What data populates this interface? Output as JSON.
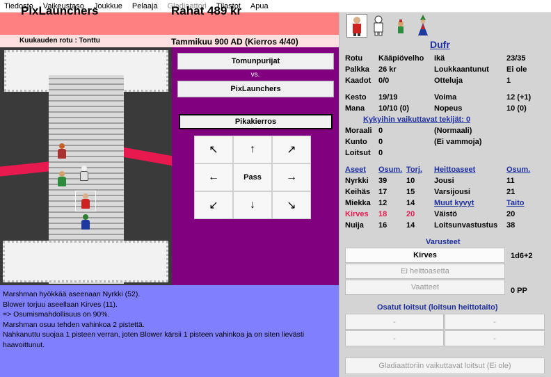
{
  "menu": [
    "Tiedosto",
    "Vaikeustaso",
    "Joukkue",
    "Pelaaja",
    "Gladiaattori",
    "Tilastot",
    "Apua"
  ],
  "header": {
    "team": "PixLaunchers",
    "money": "Rahat 489 kr",
    "race_of_month": "Kuukauden rotu : Tonttu",
    "date": "Tammikuu 900 AD (Kierros 4/40)"
  },
  "match": {
    "team1": "Tomunpurijat",
    "vs": "vs.",
    "team2": "PixLaunchers",
    "quick_round": "Pikakierros"
  },
  "directions": {
    "nw": "↖",
    "n": "↑",
    "ne": "↗",
    "w": "←",
    "pass": "Pass",
    "e": "→",
    "sw": "↙",
    "s": "↓",
    "se": "↘"
  },
  "log": [
    "Marshman hyökkää aseenaan Nyrkki (52).",
    "Blower torjuu aseellaan Kirves (11).",
    "=> Osumismahdollisuus on 90%.",
    "Marshman osuu  tehden vahinkoa 2 pistettä.",
    "Nahkanuttu suojaa 1 pisteen verran, joten Blower kärsii 1 pisteen vahinkoa ja on siten lievästi",
    "haavoittunut."
  ],
  "gladiator": {
    "name": "Dufr",
    "stats": {
      "rotu_label": "Rotu",
      "rotu": "Kääpiövelho",
      "ika_label": "Ikä",
      "ika": "23/35",
      "palkka_label": "Palkka",
      "palkka": "26 kr",
      "loukk_label": "Loukkaantunut",
      "loukk": "Ei ole",
      "kaadot_label": "Kaadot",
      "kaadot": "0/0",
      "otteluja_label": "Otteluja",
      "otteluja": "1",
      "kesto_label": "Kesto",
      "kesto": "19/19",
      "voima_label": "Voima",
      "voima": "12 (+1)",
      "mana_label": "Mana",
      "mana": "10/10 (0)",
      "nopeus_label": "Nopeus",
      "nopeus": "10 (0)"
    },
    "factors_link": "Kykyihin vaikuttavat tekijät: 0",
    "status": {
      "moraali_label": "Moraali",
      "moraali": "0",
      "moraali_desc": "(Normaali)",
      "kunto_label": "Kunto",
      "kunto": "0",
      "kunto_desc": "(Ei vammoja)",
      "loitsut_label": "Loitsut",
      "loitsut": "0"
    },
    "weapons_headers": [
      "Aseet",
      "Osum.",
      "Torj."
    ],
    "weapons": [
      {
        "name": "Nyrkki",
        "hit": "39",
        "block": "10"
      },
      {
        "name": "Keihäs",
        "hit": "17",
        "block": "15"
      },
      {
        "name": "Miekka",
        "hit": "12",
        "block": "14"
      },
      {
        "name": "Kirves",
        "hit": "18",
        "block": "20"
      },
      {
        "name": "Nuija",
        "hit": "16",
        "block": "14"
      }
    ],
    "throw_headers": [
      "Heittoaseet",
      "Osum."
    ],
    "throws": [
      {
        "name": "Jousi",
        "value": "11"
      },
      {
        "name": "Varsijousi",
        "value": "21"
      }
    ],
    "skill_headers": [
      "Muut kyvyt",
      "Taito"
    ],
    "skills": [
      {
        "name": "Väistö",
        "value": "20"
      },
      {
        "name": "Loitsunvastustus",
        "value": "38"
      }
    ]
  },
  "equipment": {
    "title": "Varusteet",
    "weapon": "Kirves",
    "damage": "1d6+2",
    "throw": "Ei heittoasetta",
    "armor": "Vaatteet",
    "pp": "0 PP"
  },
  "spells": {
    "title": "Osatut loitsut (loitsun heittotaito)",
    "slots": [
      "-",
      "-",
      "-",
      "-"
    ],
    "effects_button": "Gladiaattoriin vaikuttavat loitsut (Ei ole)"
  },
  "colors": {
    "header": "#ff8080",
    "purple": "#800080",
    "log": "#8080ff",
    "link": "#1e2fa0",
    "highlight": "#e8194f"
  }
}
